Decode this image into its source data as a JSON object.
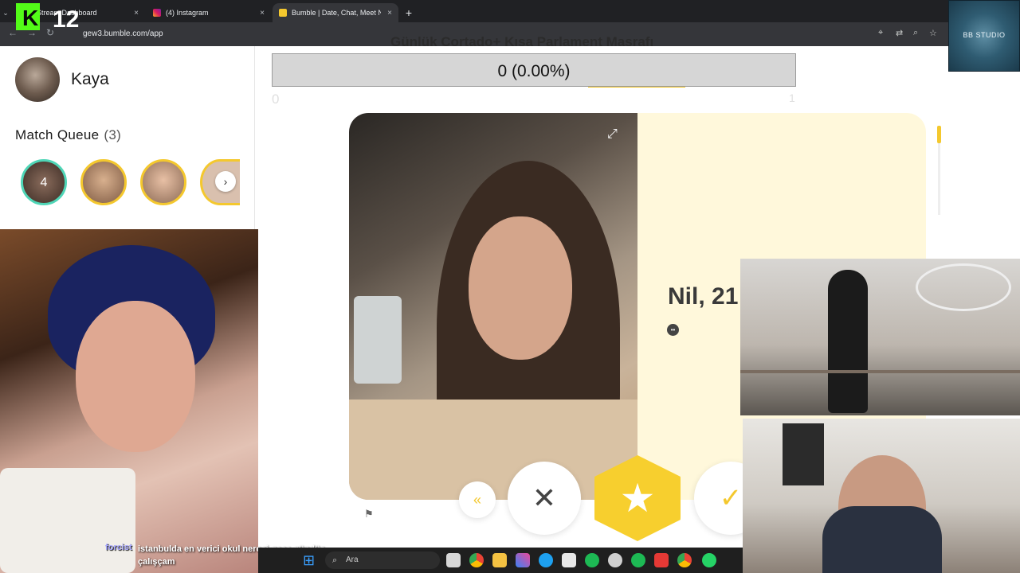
{
  "browser": {
    "tabs": [
      {
        "label": "Stream Dashboard",
        "close": "×"
      },
      {
        "label": "(4) Instagram",
        "close": "×"
      },
      {
        "label": "Bumble | Date, Chat, Meet New...",
        "close": "×"
      }
    ],
    "new_tab": "+",
    "url": "gew3.bumble.com/app"
  },
  "overlays": {
    "k12_logo": "K12",
    "studio_logo": "BB STUDIO",
    "title": "Günlük Cortado+ Kısa Parlament Masrafı",
    "progress": {
      "text": "0 (0.00%)",
      "fraction": 0.0,
      "min": "0",
      "max": "1"
    },
    "chat": {
      "user": "forcist",
      "message": "istanbulda en verici okul neresi gece gündüz çalışçam"
    }
  },
  "sidebar": {
    "username": "Kaya",
    "match_queue_label": "Match Queue",
    "match_queue_count": "(3)",
    "queue_first_count": "4"
  },
  "profile": {
    "name_age": "Nil, 21"
  },
  "actions": {
    "back": "«",
    "pass": "✕",
    "superswipe": "★",
    "like": "✓"
  },
  "taskbar": {
    "search_placeholder": "Ara"
  },
  "colors": {
    "bumble_yellow": "#f4c82e",
    "info_panel": "#fff8db",
    "queue_ring_active": "#4fd6b7"
  }
}
